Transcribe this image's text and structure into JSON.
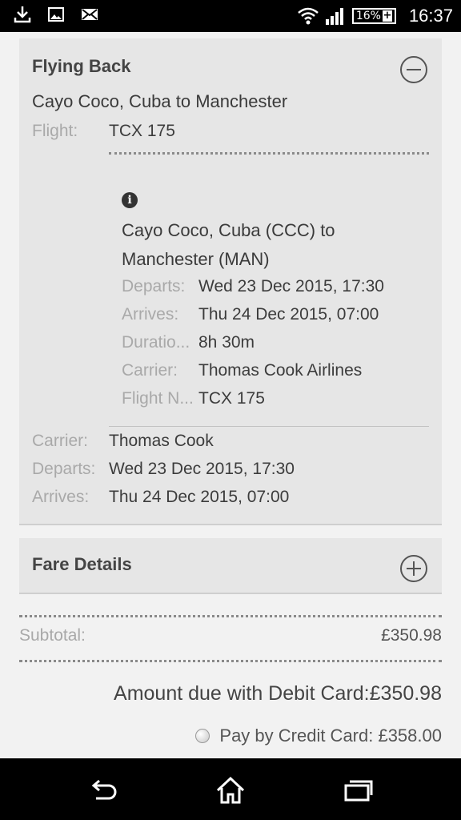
{
  "status_bar": {
    "icons": [
      "download-icon",
      "image-icon",
      "mail-icon",
      "wifi-icon",
      "signal-icon"
    ],
    "battery": "16%",
    "time": "16:37"
  },
  "flying_back": {
    "title": "Flying Back",
    "toggle_icon": "minus-circle-icon",
    "route": "Cayo Coco, Cuba to Manchester",
    "flight_label": "Flight:",
    "flight_value": "TCX 175",
    "detail": {
      "info_icon": "info-icon",
      "route": "Cayo Coco, Cuba (CCC) to Manchester (MAN)",
      "departs_label": "Departs:",
      "departs_value": "Wed 23 Dec 2015, 17:30",
      "arrives_label": "Arrives:",
      "arrives_value": "Thu 24 Dec 2015, 07:00",
      "duration_label": "Duratio...",
      "duration_value": "8h 30m",
      "carrier_label": "Carrier:",
      "carrier_value": "Thomas Cook Airlines",
      "flight_no_label": "Flight N...",
      "flight_no_value": "TCX 175"
    },
    "carrier_label": "Carrier:",
    "carrier_value": "Thomas Cook",
    "departs_label": "Departs:",
    "departs_value": "Wed 23 Dec 2015, 17:30",
    "arrives_label": "Arrives:",
    "arrives_value": "Thu 24 Dec 2015, 07:00"
  },
  "fare_details": {
    "title": "Fare Details",
    "toggle_icon": "plus-circle-icon"
  },
  "totals": {
    "subtotal_label": "Subtotal:",
    "subtotal_value": "£350.98",
    "amount_due": "Amount due with Debit Card:£350.98",
    "pay_credit": "Pay by Credit Card: £358.00"
  },
  "nav_bar": {
    "icons": [
      "back-icon",
      "home-icon",
      "recent-apps-icon"
    ]
  }
}
